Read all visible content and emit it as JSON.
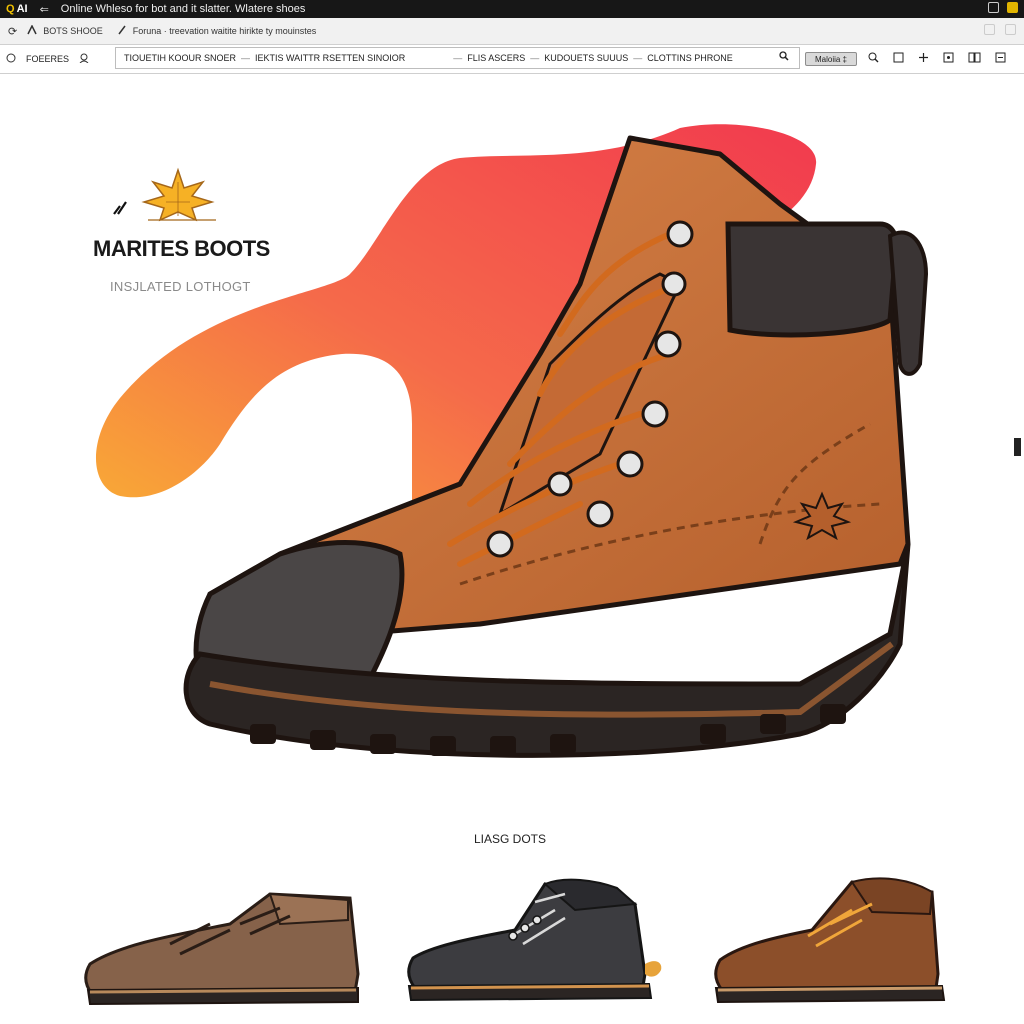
{
  "window": {
    "app_badge": "AI",
    "back_glyph": "⇐",
    "title": "Online Whleso for bot and it slatter. Wlatere shoes"
  },
  "tabs": {
    "reload_glyph": "⟳",
    "tab1_label": "BOTS SHOOE",
    "tab2_label": "Foruna ·  treevation waitite hirikte ty mouinstes"
  },
  "nav": {
    "menu_label": "FOEERES",
    "address_links": [
      "TIOUETIH KOOUR SNOER",
      "IEKTIS WAITTR RSETTEN SINOIOR",
      "FLIS ASCERS",
      "KUDOUETS SUUUS",
      "CLOTTINS PHRONE"
    ],
    "search_button": "Maloiia ‡"
  },
  "brand": {
    "name": "MARITES BOOTS",
    "subtitle": "INSJLATED LOTHOGT",
    "mark_glyph": "\\/"
  },
  "related": {
    "title": "LIASG DOTS"
  },
  "colors": {
    "accent_gradient_start": "#f9b233",
    "accent_gradient_mid": "#f56a4a",
    "accent_gradient_end": "#f23a4e",
    "boot_leather": "#c46a35",
    "boot_sole": "#2b2523",
    "laces": "#d26a1e"
  }
}
